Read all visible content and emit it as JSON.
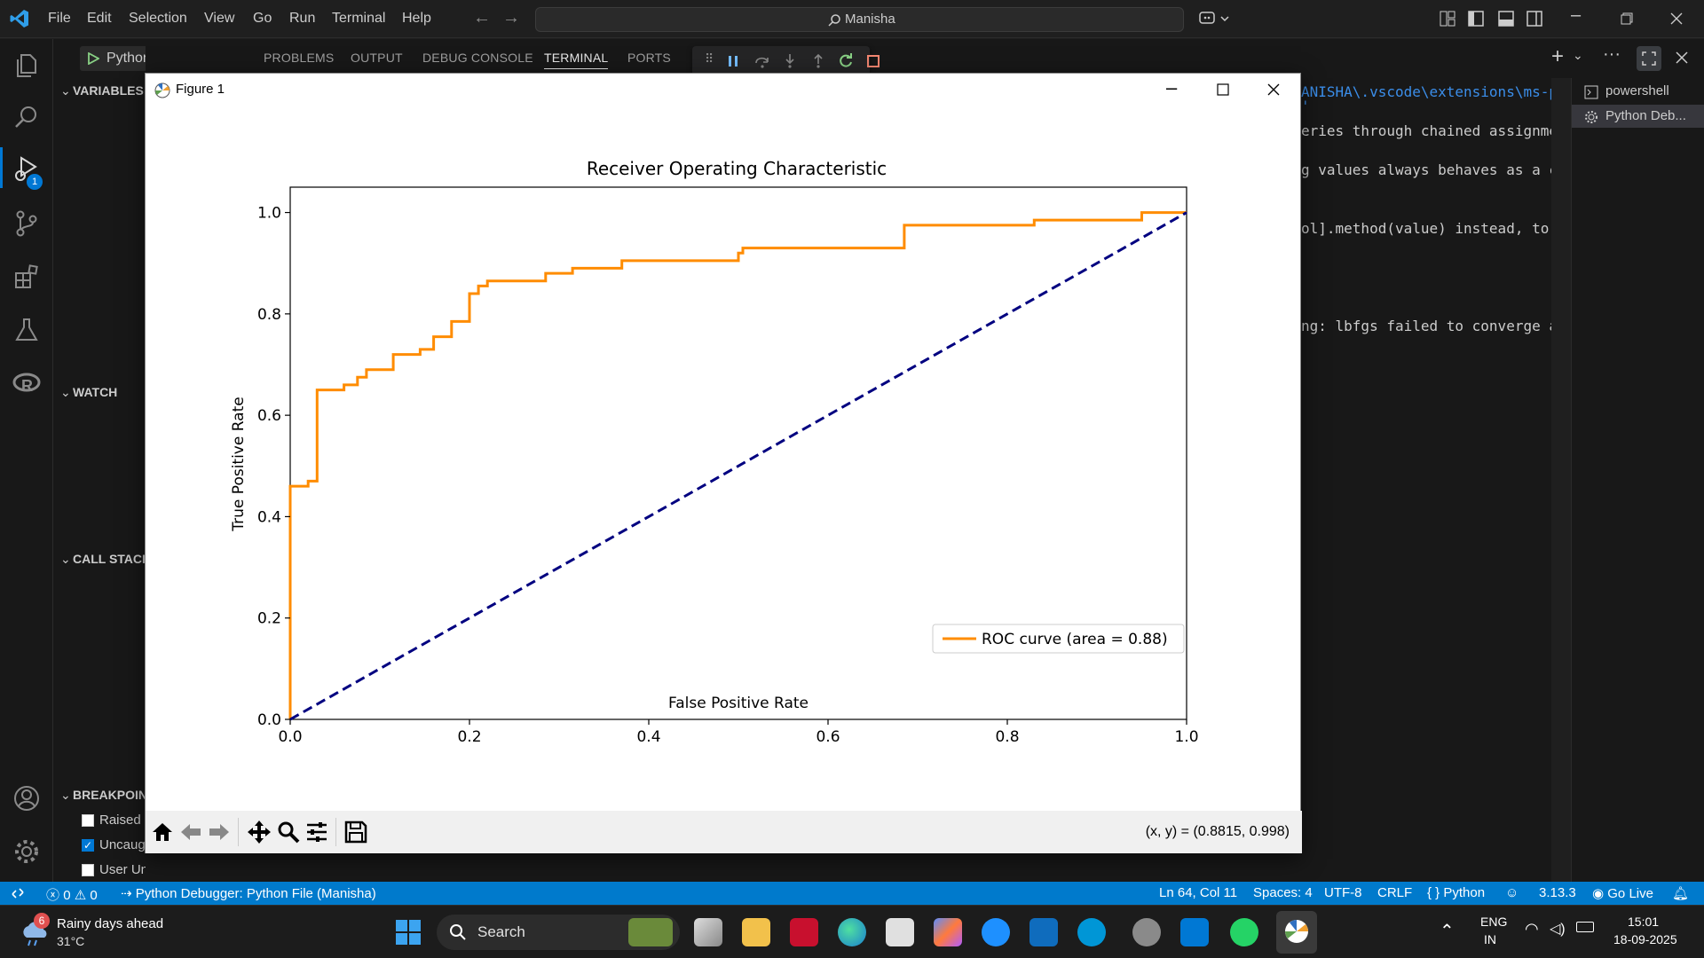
{
  "menu": {
    "file": "File",
    "edit": "Edit",
    "selection": "Selection",
    "view": "View",
    "go": "Go",
    "run": "Run",
    "terminal": "Terminal",
    "help": "Help"
  },
  "search": {
    "text": "Manisha"
  },
  "debug_config": {
    "label": "Python De"
  },
  "activity": {
    "run_badge": "1"
  },
  "sidebar": {
    "variables": "VARIABLES",
    "watch": "WATCH",
    "call_stack": "CALL STACK",
    "breakpoints": "BREAKPOIN",
    "breakpoint_items": [
      {
        "label": "Raised",
        "checked": false
      },
      {
        "label": "Uncaug",
        "checked": true
      },
      {
        "label": "User Uncaught E...",
        "checked": false
      }
    ]
  },
  "panel": {
    "tabs": [
      "PROBLEMS",
      "OUTPUT",
      "DEBUG CONSOLE",
      "TERMINAL",
      "PORTS"
    ],
    "active_tab": "TERMINAL"
  },
  "terminal": {
    "lines": [
      "ANISHA\\.vscode\\extensions\\ms-py",
      "'",
      "eries through chained assignment",
      "g values always behaves as a co",
      "ol].method(value) instead, to p",
      "ng: lbfgs failed to converge af"
    ],
    "sessions": [
      "powershell",
      "Python Deb..."
    ]
  },
  "figure": {
    "window_title": "Figure 1",
    "coord_readout": "(x, y) = (0.8815, 0.998)"
  },
  "chart_data": {
    "type": "line",
    "title": "Receiver Operating Characteristic",
    "xlabel": "False Positive Rate",
    "ylabel": "True Positive Rate",
    "xlim": [
      0.0,
      1.0
    ],
    "ylim": [
      0.0,
      1.05
    ],
    "xticks": [
      "0.0",
      "0.2",
      "0.4",
      "0.6",
      "0.8",
      "1.0"
    ],
    "yticks": [
      "0.0",
      "0.2",
      "0.4",
      "0.6",
      "0.8",
      "1.0"
    ],
    "grid": false,
    "legend_position": "lower-right",
    "series": [
      {
        "name": "ROC curve (area = 0.88)",
        "color": "#ff8c00",
        "style": "solid",
        "x": [
          0.0,
          0.0,
          0.0,
          0.02,
          0.02,
          0.03,
          0.03,
          0.06,
          0.06,
          0.075,
          0.075,
          0.085,
          0.085,
          0.115,
          0.115,
          0.145,
          0.145,
          0.16,
          0.16,
          0.18,
          0.18,
          0.2,
          0.2,
          0.21,
          0.21,
          0.22,
          0.22,
          0.285,
          0.285,
          0.315,
          0.315,
          0.37,
          0.37,
          0.5,
          0.5,
          0.505,
          0.505,
          0.685,
          0.685,
          0.83,
          0.83,
          0.95,
          0.95,
          1.0
        ],
        "y": [
          0.0,
          0.46,
          0.46,
          0.46,
          0.47,
          0.47,
          0.65,
          0.65,
          0.66,
          0.66,
          0.675,
          0.675,
          0.69,
          0.69,
          0.72,
          0.72,
          0.73,
          0.73,
          0.755,
          0.755,
          0.785,
          0.785,
          0.84,
          0.84,
          0.855,
          0.855,
          0.865,
          0.865,
          0.88,
          0.88,
          0.89,
          0.89,
          0.905,
          0.905,
          0.92,
          0.92,
          0.93,
          0.93,
          0.975,
          0.975,
          0.985,
          0.985,
          1.0,
          1.0
        ]
      },
      {
        "color": "#000080",
        "style": "dashed",
        "x": [
          0.0,
          1.0
        ],
        "y": [
          0.0,
          1.0
        ]
      }
    ]
  },
  "status": {
    "errors": "0",
    "warnings": "0",
    "debug_target": "Python Debugger: Python File (Manisha)",
    "position": "Ln 64, Col 11",
    "spaces": "Spaces: 4",
    "encoding": "UTF-8",
    "eol": "CRLF",
    "language": "Python",
    "python_version": "3.13.3",
    "go_live": "Go Live"
  },
  "taskbar": {
    "weather_badge": "6",
    "weather_title": "Rainy days ahead",
    "weather_temp": "31°C",
    "search": "Search",
    "lang_top": "ENG",
    "lang_bottom": "IN",
    "time": "15:01",
    "date": "18-09-2025"
  }
}
